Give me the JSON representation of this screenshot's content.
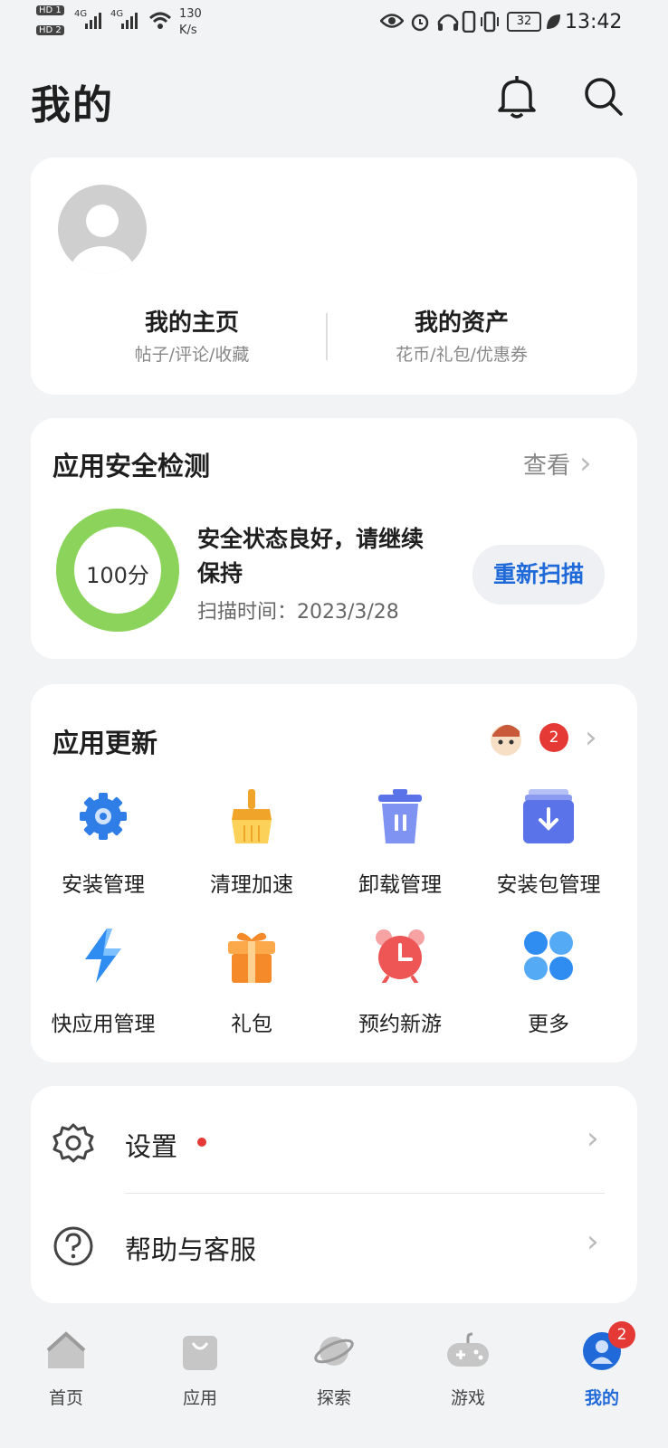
{
  "status_bar": {
    "hd1": "HD 1",
    "hd2": "HD 2",
    "net1": "4G",
    "net2": "4G",
    "speed_value": "130",
    "speed_unit": "K/s",
    "battery": "32",
    "time": "13:42"
  },
  "header": {
    "title": "我的"
  },
  "profile": {
    "home_title": "我的主页",
    "home_sub": "帖子/评论/收藏",
    "assets_title": "我的资产",
    "assets_sub": "花币/礼包/优惠券"
  },
  "security": {
    "title": "应用安全检测",
    "view_label": "查看",
    "score": "100分",
    "status_line1": "安全状态良好，请继续",
    "status_line2": "保持",
    "scan_time": "扫描时间：2023/3/28",
    "rescan_label": "重新扫描",
    "score_fraction": 1.0,
    "ring_color": "#8bd35a"
  },
  "updates": {
    "title": "应用更新",
    "badge_count": "2",
    "items": [
      {
        "label": "安装管理",
        "icon": "install-gear-icon"
      },
      {
        "label": "清理加速",
        "icon": "broom-icon"
      },
      {
        "label": "卸载管理",
        "icon": "trash-icon"
      },
      {
        "label": "安装包管理",
        "icon": "package-download-icon"
      },
      {
        "label": "快应用管理",
        "icon": "lightning-icon"
      },
      {
        "label": "礼包",
        "icon": "gift-icon"
      },
      {
        "label": "预约新游",
        "icon": "alarm-clock-icon"
      },
      {
        "label": "更多",
        "icon": "more-grid-icon"
      }
    ]
  },
  "menu": {
    "settings_label": "设置",
    "help_label": "帮助与客服"
  },
  "bottom_nav": {
    "items": [
      {
        "label": "首页",
        "icon": "home-icon"
      },
      {
        "label": "应用",
        "icon": "bag-icon"
      },
      {
        "label": "探索",
        "icon": "planet-icon"
      },
      {
        "label": "游戏",
        "icon": "gamepad-icon"
      },
      {
        "label": "我的",
        "icon": "profile-icon"
      }
    ],
    "mine_badge": "2",
    "active_color": "#1f6ad8"
  }
}
